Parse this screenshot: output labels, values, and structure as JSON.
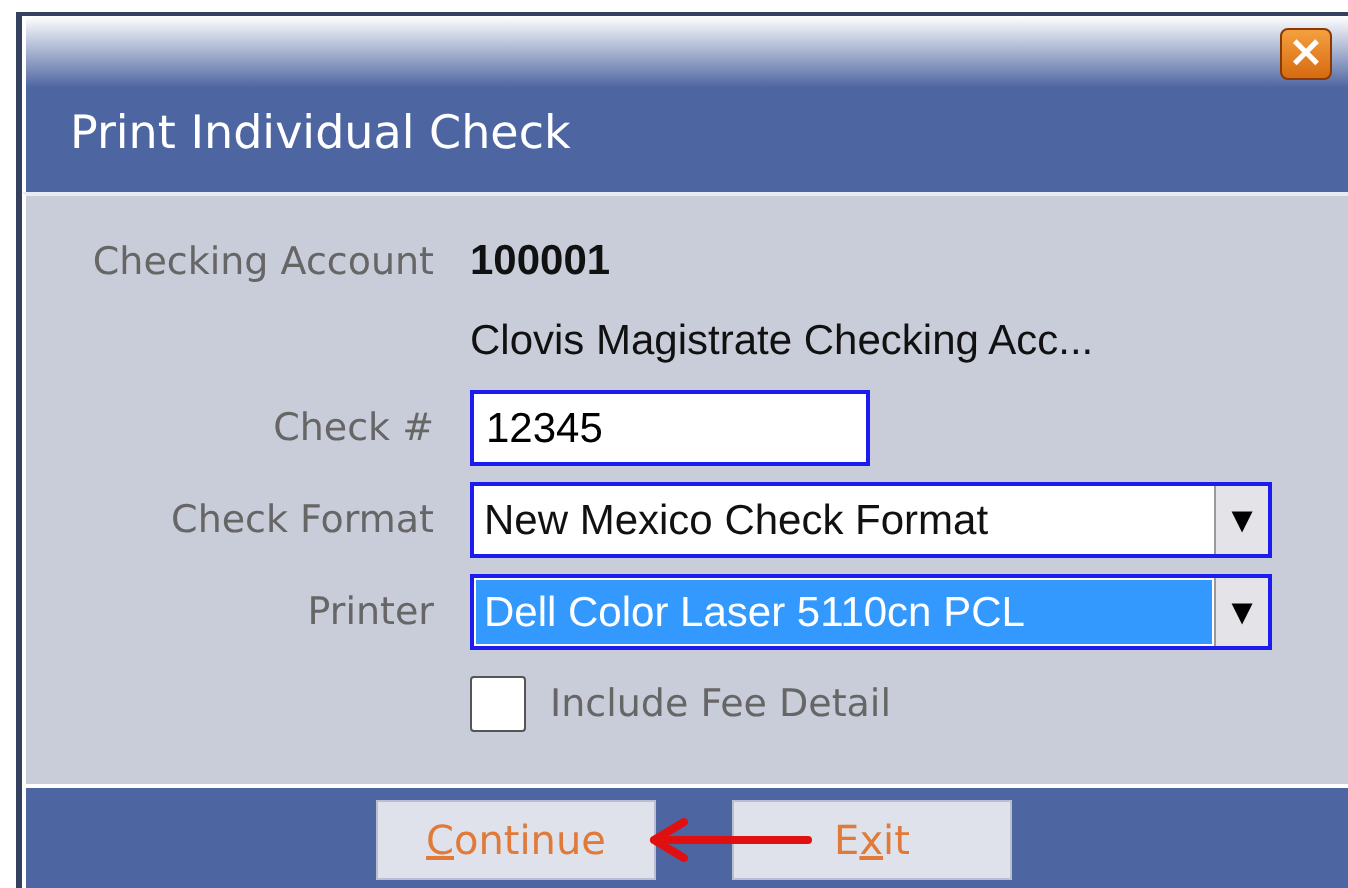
{
  "window": {
    "title": "Print Individual Check",
    "close_glyph": "×"
  },
  "fields": [
    {
      "kind": "text",
      "label": "Checking Account",
      "value": "100001"
    },
    {
      "kind": "note",
      "value": "Clovis Magistrate Checking Acc..."
    },
    {
      "kind": "input",
      "label": "Check #",
      "value": "12345"
    },
    {
      "kind": "select",
      "label": "Check Format",
      "value": "New Mexico Check Format",
      "highlighted": false,
      "arrow": "▼"
    },
    {
      "kind": "select",
      "label": "Printer",
      "value": "Dell Color Laser 5110cn PCL",
      "highlighted": true,
      "arrow": "▼"
    },
    {
      "kind": "checkbox",
      "label": "Include Fee Detail",
      "checked": false
    }
  ],
  "buttons": [
    {
      "label": "Continue",
      "pointed_at": true
    },
    {
      "label": "Exit",
      "pointed_at": false
    }
  ]
}
